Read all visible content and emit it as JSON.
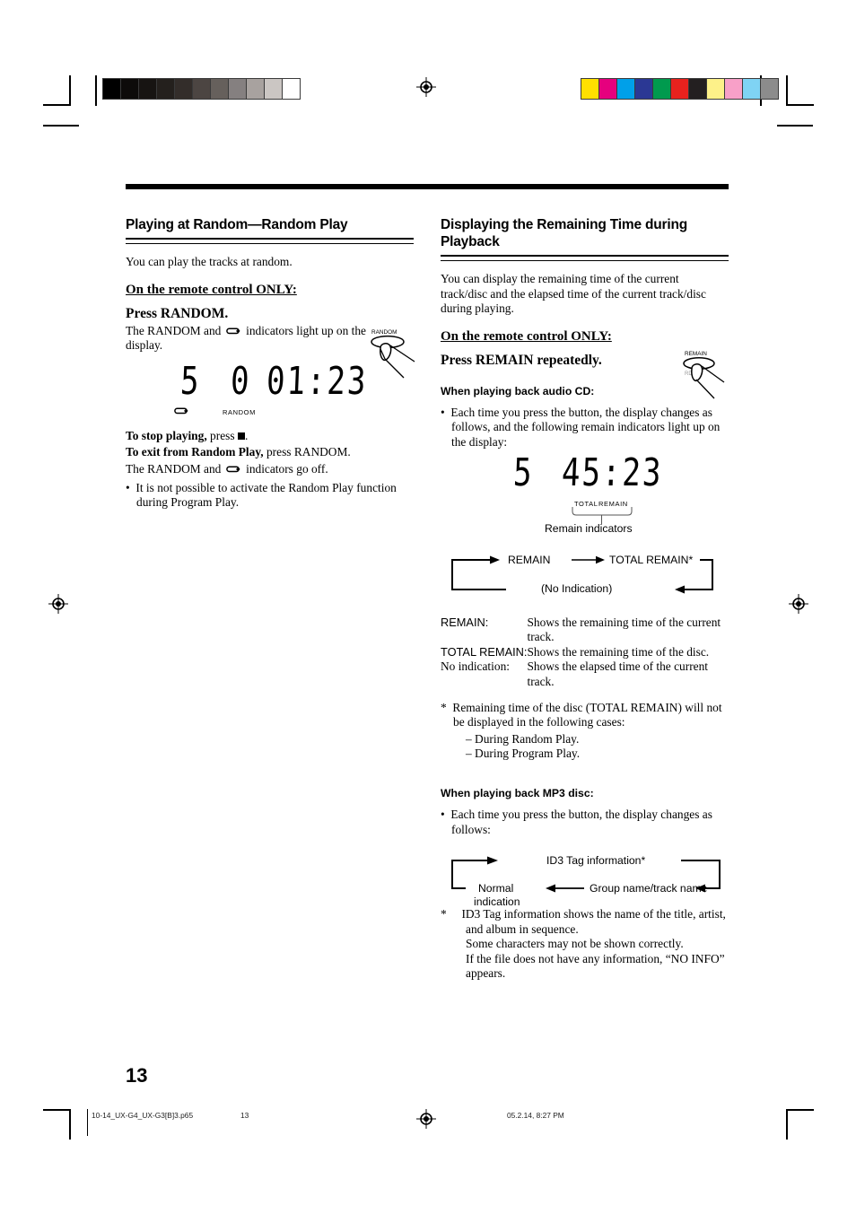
{
  "page": {
    "number": "13",
    "footer_file": "10-14_UX-G4_UX-G3[B]3.p65",
    "footer_page": "13",
    "footer_date": "05.2.14, 8:27 PM"
  },
  "print_marks": {
    "grayscale_patches": [
      "#000000",
      "#0d0b0a",
      "#171412",
      "#24201d",
      "#332d2a",
      "#4c4542",
      "#66605c",
      "#858080",
      "#a8a29f",
      "#cbc6c3",
      "#ffffff"
    ],
    "color_patches": [
      "#ffe000",
      "#e6007e",
      "#00a0e9",
      "#2b3894",
      "#009a4e",
      "#e8221e",
      "#231f20",
      "#fdf189",
      "#f8a0c8",
      "#7fd3f4",
      "#8c8c8c"
    ]
  },
  "left_column": {
    "heading": "Playing at Random—Random Play",
    "intro": "You can play the tracks at random.",
    "remote_only": "On the remote control ONLY:",
    "press_title": "Press RANDOM.",
    "press_desc_pre": "The RANDOM and",
    "press_desc_post": "indicators light up on the",
    "press_desc_line2": "display.",
    "button_illustration_label": "RANDOM",
    "display": {
      "track": "5",
      "digits": "01:23",
      "zero": "0",
      "indicator_label": "RANDOM",
      "repeat_icon": "repeat-arrow-icon"
    },
    "stop_bold": "To stop playing,",
    "stop_rest": "press",
    "exit_bold": "To exit from Random Play,",
    "exit_rest": "press RANDOM.",
    "goes_off_pre": "The RANDOM and",
    "goes_off_post": "indicators go off.",
    "note": "It is not possible to activate the Random Play function during Program Play."
  },
  "right_column": {
    "heading": "Displaying the Remaining Time during Playback",
    "intro": "You can display the remaining time of the current track/disc and the elapsed time of the current track/disc during playing.",
    "remote_only": "On the remote control ONLY:",
    "press_title": "Press REMAIN repeatedly.",
    "button_illustration_label": "REMAIN",
    "button_illustration_sublabel": "RDS",
    "cd_subhead": "When playing back audio CD:",
    "cd_bullet": "Each time you press the button, the display changes as follows, and the following remain indicators light up on the display:",
    "display": {
      "track": "5",
      "digits": "45:23",
      "indicator_total": "TOTAL",
      "indicator_remain": "REMAIN",
      "callout": "Remain indicators"
    },
    "cd_cycle": {
      "step1": "REMAIN",
      "step2": "TOTAL REMAIN*",
      "step3": "(No Indication)"
    },
    "definitions": [
      {
        "term": "REMAIN:",
        "desc": "Shows the remaining time of the current track."
      },
      {
        "term": "TOTAL REMAIN:",
        "desc": "Shows the remaining time of the disc."
      },
      {
        "term": "No indication:",
        "desc": "Shows the elapsed time of the current track."
      }
    ],
    "footnote_cd": "Remaining time of the disc (TOTAL REMAIN) will not be displayed in the following cases:",
    "footnote_cd_items": [
      "– During Random Play.",
      "– During Program Play."
    ],
    "mp3_subhead": "When playing back MP3 disc:",
    "mp3_bullet": "Each time you press the button, the display changes as follows:",
    "mp3_cycle": {
      "step1_line1": "Normal",
      "step1_line2": "indication",
      "step2": "ID3 Tag information*",
      "step3": "Group name/track name"
    },
    "footnote_mp3_lines": [
      "ID3 Tag information shows the name of the title, artist, and album in sequence.",
      "Some characters may not be shown correctly.",
      "If the file does not have any information, “NO INFO” appears."
    ]
  }
}
